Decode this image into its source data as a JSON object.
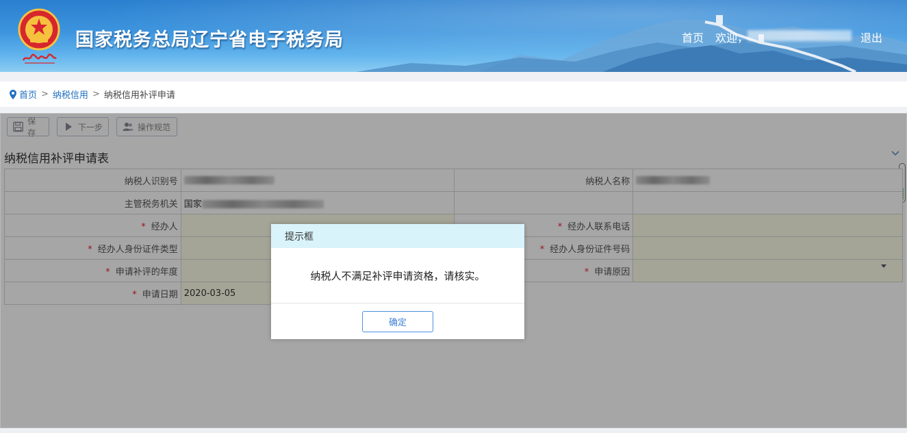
{
  "header": {
    "title": "国家税务总局辽宁省电子税务局",
    "emblem_caption": "中国税务",
    "nav_home": "首页",
    "nav_welcome": "欢迎，",
    "nav_logout": "退出"
  },
  "breadcrumb": {
    "home": "首页",
    "separator": ">",
    "level1": "纳税信用",
    "current": "纳税信用补评申请"
  },
  "toolbar": {
    "save_label": "保存",
    "next_label": "下一步",
    "guide_label": "操作规范"
  },
  "form": {
    "title": "纳税信用补评申请表",
    "required_mark": "*",
    "labels": {
      "taxpayer_id": "纳税人识别号",
      "taxpayer_name": "纳税人名称",
      "tax_authority": "主管税务机关",
      "agent": "经办人",
      "agent_phone": "经办人联系电话",
      "agent_id_type": "经办人身份证件类型",
      "agent_id_number": "经办人身份证件号码",
      "review_year": "申请补评的年度",
      "reason": "申请原因",
      "apply_date": "申请日期"
    },
    "values": {
      "tax_authority_prefix": "国家",
      "apply_date": "2020-03-05"
    }
  },
  "dialog": {
    "title": "提示框",
    "message": "纳税人不满足补评申请资格，请核实。",
    "ok_label": "确定"
  },
  "colors": {
    "header_blue": "#3d95de",
    "link_blue": "#1f6fc0",
    "required_red": "#e23",
    "dialog_head": "#d9f3fb",
    "ok_border": "#4a8fe0"
  }
}
